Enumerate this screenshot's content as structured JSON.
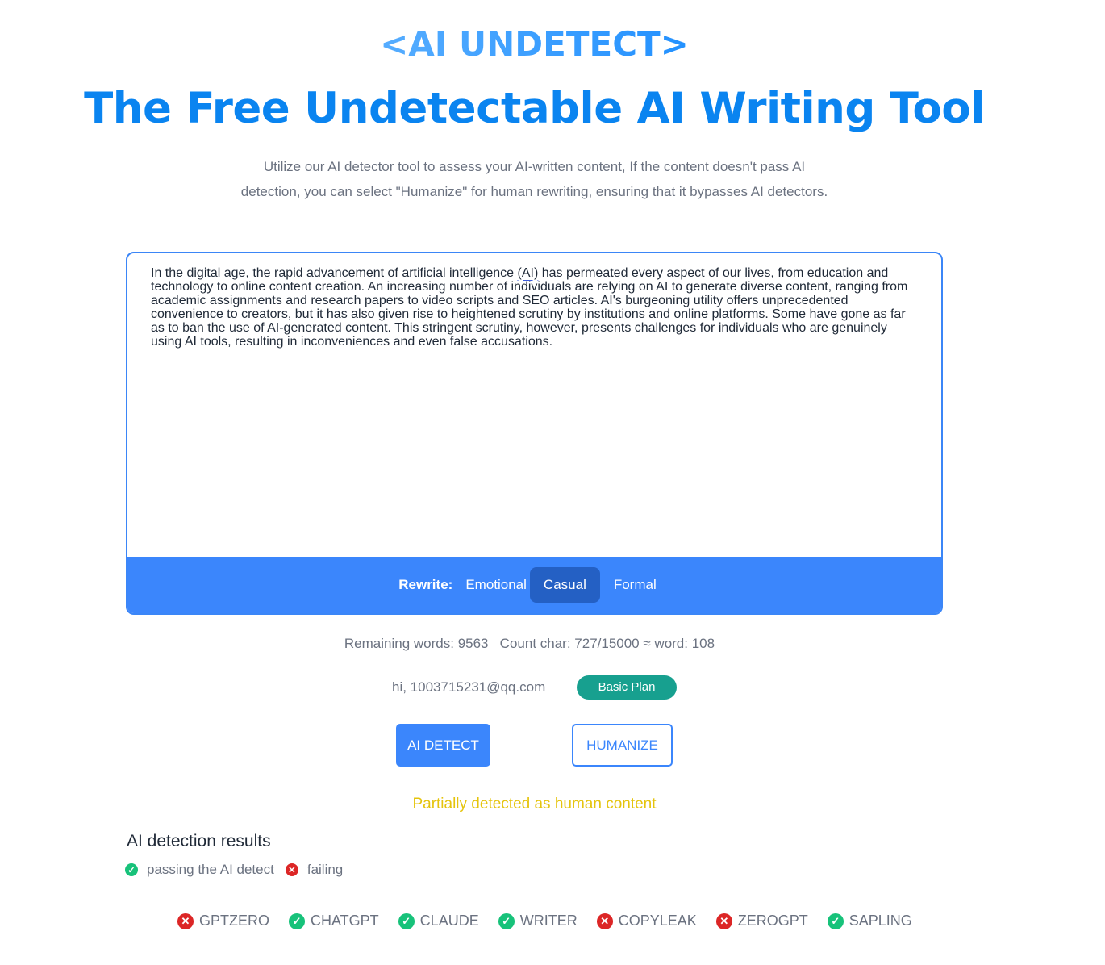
{
  "logo": "<AI UNDETECT>",
  "title": "The Free Undetectable AI Writing Tool",
  "subtitle": "Utilize our AI detector tool to assess your AI-written content, If the content doesn't pass AI detection, you can select \"Humanize\" for human rewriting, ensuring that it bypasses AI detectors.",
  "editor": {
    "text_before": "In the digital age, the rapid advancement of artificial intelligence ",
    "text_marked": "(AI)",
    "text_after": " has permeated every aspect of our lives, from education and technology to online content creation. An increasing number of individuals are relying on AI to generate diverse content, ranging from academic assignments and research papers to video scripts and SEO articles. AI's burgeoning utility offers unprecedented convenience to creators, but it has also given rise to heightened scrutiny by institutions and online platforms. Some have gone as far as to ban the use of AI-generated content. This stringent scrutiny, however, presents challenges for individuals who are genuinely using AI tools, resulting in inconveniences and even false accusations."
  },
  "rewrite": {
    "label": "Rewrite:",
    "options": [
      "Emotional",
      "Casual",
      "Formal"
    ],
    "selected": "Casual"
  },
  "stats": "Remaining words: 9563   Count char: 727/15000 ≈ word: 108",
  "user": "hi, 1003715231@qq.com",
  "plan": "Basic Plan",
  "buttons": {
    "detect": "AI DETECT",
    "humanize": "HUMANIZE"
  },
  "status": "Partially detected as human content",
  "results": {
    "title": "AI detection results",
    "legend_pass": "passing the AI detect",
    "legend_fail": "failing",
    "detectors": [
      {
        "name": "GPTZERO",
        "pass": false
      },
      {
        "name": "CHATGPT",
        "pass": true
      },
      {
        "name": "CLAUDE",
        "pass": true
      },
      {
        "name": "WRITER",
        "pass": true
      },
      {
        "name": "COPYLEAK",
        "pass": false
      },
      {
        "name": "ZEROGPT",
        "pass": false
      },
      {
        "name": "SAPLING",
        "pass": true
      }
    ]
  },
  "colors": {
    "accent": "#3b86fc",
    "pass": "#17c27a",
    "fail": "#dc2626",
    "status": "#e5c40d",
    "plan": "#17a08f"
  }
}
